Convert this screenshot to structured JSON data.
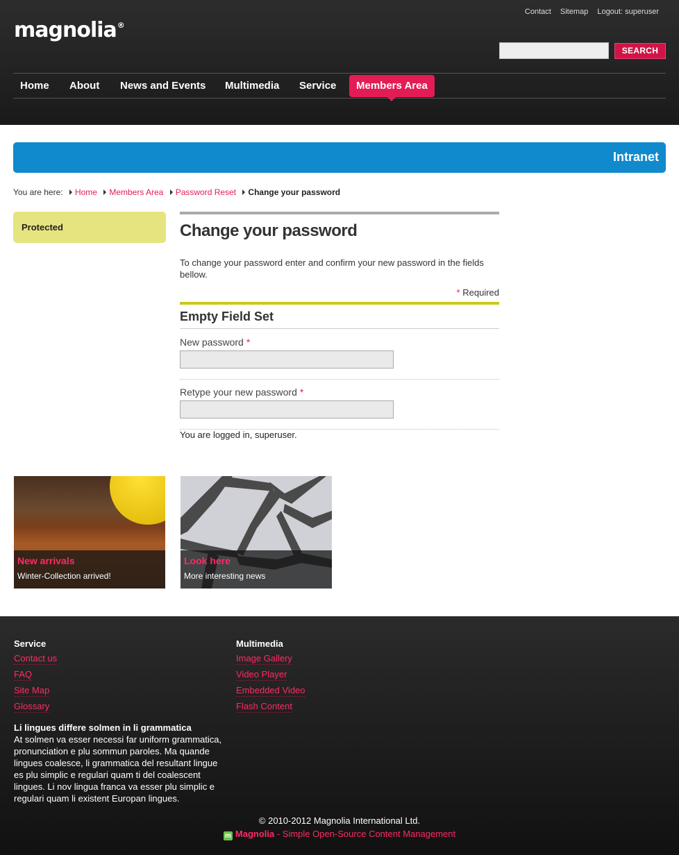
{
  "header": {
    "logo": "magnolia",
    "logo_mark": "®",
    "top_links": [
      "Contact",
      "Sitemap",
      "Logout: superuser"
    ],
    "search_button": "SEARCH",
    "search_value": ""
  },
  "nav": {
    "items": [
      "Home",
      "About",
      "News and Events",
      "Multimedia",
      "Service",
      "Members Area"
    ],
    "active": "Members Area"
  },
  "intranet_label": "Intranet",
  "breadcrumb": {
    "prefix": "You are here:",
    "links": [
      "Home",
      "Members Area",
      "Password Reset"
    ],
    "current": "Change your password"
  },
  "sidebar": {
    "protected_label": "Protected"
  },
  "main": {
    "title": "Change your password",
    "intro": "To change your password enter and confirm your new password in the fields bellow.",
    "required_star": "*",
    "required_label": "Required",
    "fieldset_title": "Empty Field Set",
    "fields": [
      {
        "label": "New password",
        "value": ""
      },
      {
        "label": "Retype your new password",
        "value": ""
      }
    ],
    "logged_in_text": "You are logged in, superuser."
  },
  "teasers": [
    {
      "title": "New arrivals",
      "text": "Winter-Collection arrived!"
    },
    {
      "title": "Look here",
      "text": "More interesting news"
    }
  ],
  "footer": {
    "columns": [
      {
        "title": "Service",
        "links": [
          "Contact us",
          "FAQ",
          "Site Map",
          "Glossary"
        ]
      },
      {
        "title": "Multimedia",
        "links": [
          "Image Gallery",
          "Video Player",
          "Embedded Video",
          "Flash Content"
        ]
      }
    ],
    "text_title": "Li lingues differe solmen in li grammatica",
    "text_body": "At solmen va esser necessi far uniform grammatica, pronunciation e plu sommun paroles. Ma quande lingues coalesce, li grammatica del resultant lingue es plu simplic e regulari quam ti del coalescent lingues. Li nov lingua franca va esser plu simplic e regulari quam li existent Europan lingues.",
    "copyright": "© 2010-2012 Magnolia International Ltd.",
    "tagline_brand": "Magnolia",
    "tagline_rest": " - Simple Open-Source Content Management"
  },
  "colors": {
    "accent": "#e41c55",
    "intranet_bar": "#108acc",
    "protected_box": "#e6e47f",
    "fieldset_bar": "#c9c918"
  }
}
